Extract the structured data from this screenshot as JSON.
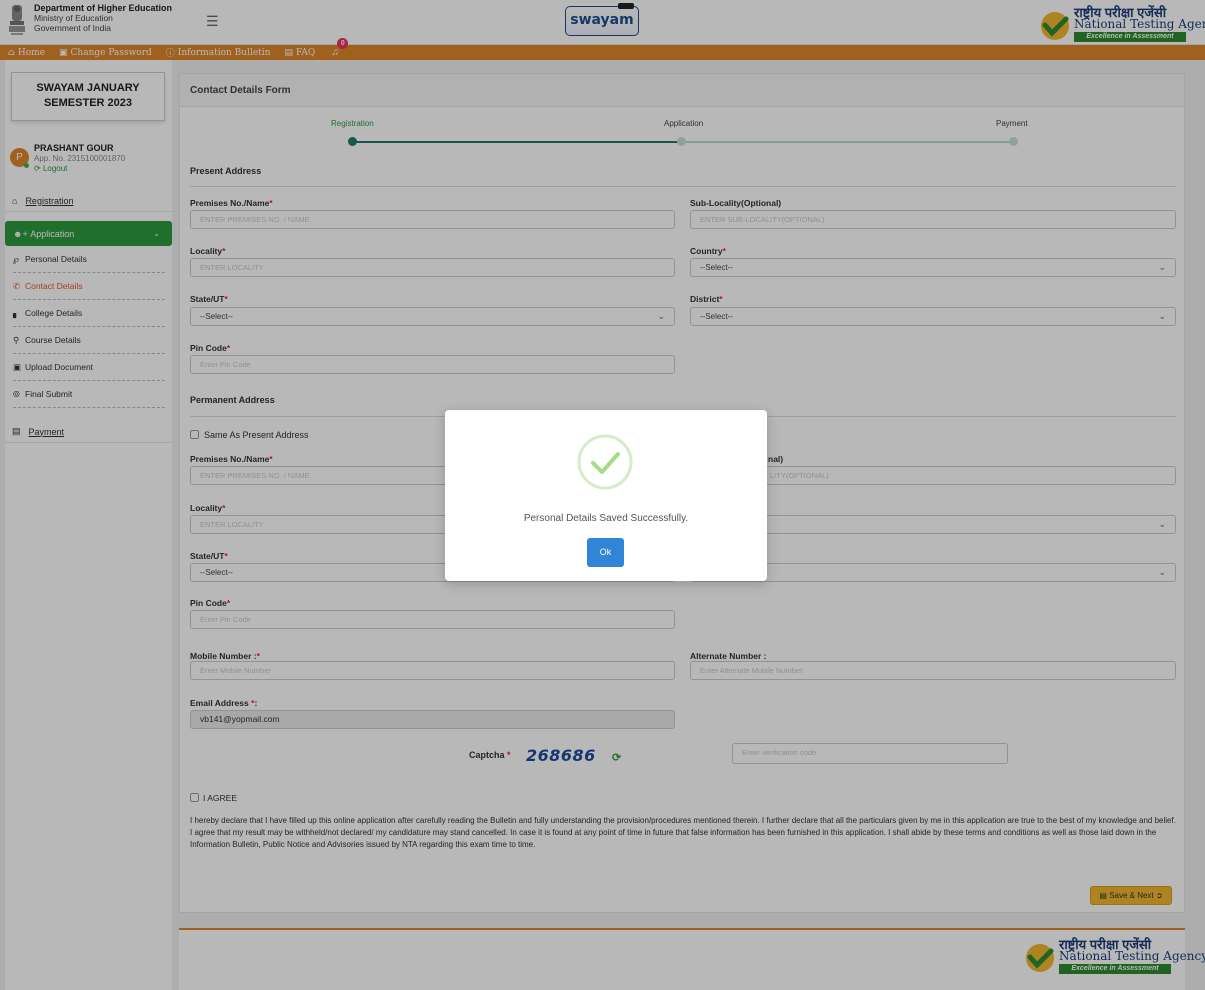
{
  "header": {
    "dept_line1": "Department of Higher Education",
    "dept_line2": "Ministry of Education",
    "dept_line3": "Government of India",
    "center_logo": "swayam",
    "nta_hindi": "राष्ट्रीय परीक्षा एजेंसी",
    "nta_english": "National Testing Agency",
    "nta_tagline": "Excellence in Assessment"
  },
  "nav": {
    "home": "Home",
    "change_password": "Change Password",
    "info_bulletin": "Information Bulletin",
    "faq": "FAQ",
    "notification_count": "0"
  },
  "sidebar": {
    "semester_line1": "SWAYAM JANUARY",
    "semester_line2": "SEMESTER 2023",
    "avatar_letter": "P",
    "user_name": "PRASHANT GOUR",
    "app_no": "App. No. 2315100001870",
    "logout": "Logout",
    "registration": "Registration",
    "application": "Application",
    "items": [
      {
        "label": "Personal Details",
        "icon": "person-icon"
      },
      {
        "label": "Contact Details",
        "icon": "phone-icon"
      },
      {
        "label": "College Details",
        "icon": "bank-icon"
      },
      {
        "label": "Course Details",
        "icon": "bulb-icon"
      },
      {
        "label": "Upload Document",
        "icon": "upload-icon"
      },
      {
        "label": "Final Submit",
        "icon": "submit-icon"
      }
    ],
    "payment": "Payment"
  },
  "form": {
    "title": "Contact Details Form",
    "steps": [
      "Registration",
      "Application",
      "Payment"
    ],
    "present_title": "Present Address",
    "permanent_title": "Permanent Address",
    "premises_label": "Premises No./Name",
    "premises_ph": "ENTER PREMISES NO. / NAME",
    "sublocality_label": "Sub-Locality(Optional)",
    "sublocality_ph": "ENTER SUB-LOCALITY(OPTIONAL)",
    "locality_label": "Locality",
    "locality_ph": "ENTER LOCALITY",
    "country_label": "Country",
    "state_label": "State/UT",
    "district_label": "District",
    "select_value": "--Select--",
    "pincode_label": "Pin Code",
    "pincode_ph": "Enter Pin Code",
    "same_as_present": "Same As Present Address",
    "perm_sublocality_partial": "nal)",
    "perm_sublocality_ph_partial": "LITY(OPTIONAL)",
    "mobile_label": "Mobile Number :",
    "mobile_ph": "Enter Mobile Number",
    "alternate_label": "Alternate Number :",
    "alternate_ph": "Enter Alternate Mobile Number",
    "email_label": "Email Address",
    "email_suffix": ":",
    "email_value": "vb141@yopmail.com",
    "captcha_label": "Captcha",
    "captcha_code": "268686",
    "captcha_ph": "Enter verification code",
    "agree_label": "I AGREE",
    "declaration": "I hereby declare that I have filled up this online application after carefully reading the Bulletin and fully understanding the provision/procedures mentioned therein. I further declare that all the particulars given by me in this application are true to the best of my knowledge and belief. I agree that my result may be withheld/not declared/ my candidature may stand cancelled. In case it is found at any point of time in future that false information has been furnished in this application. I shall abide by these terms and conditions as well as those laid down in the Information Bulletin, Public Notice and Advisories issued by NTA regarding this exam time to time.",
    "save_next": "Save & Next"
  },
  "modal": {
    "message": "Personal Details Saved Successfully.",
    "ok": "Ok"
  },
  "colors": {
    "orange": "#e0872a",
    "green": "#2e9a3f",
    "teal": "#1f7a6c",
    "blue": "#3085d6",
    "yellow": "#f2b830"
  }
}
